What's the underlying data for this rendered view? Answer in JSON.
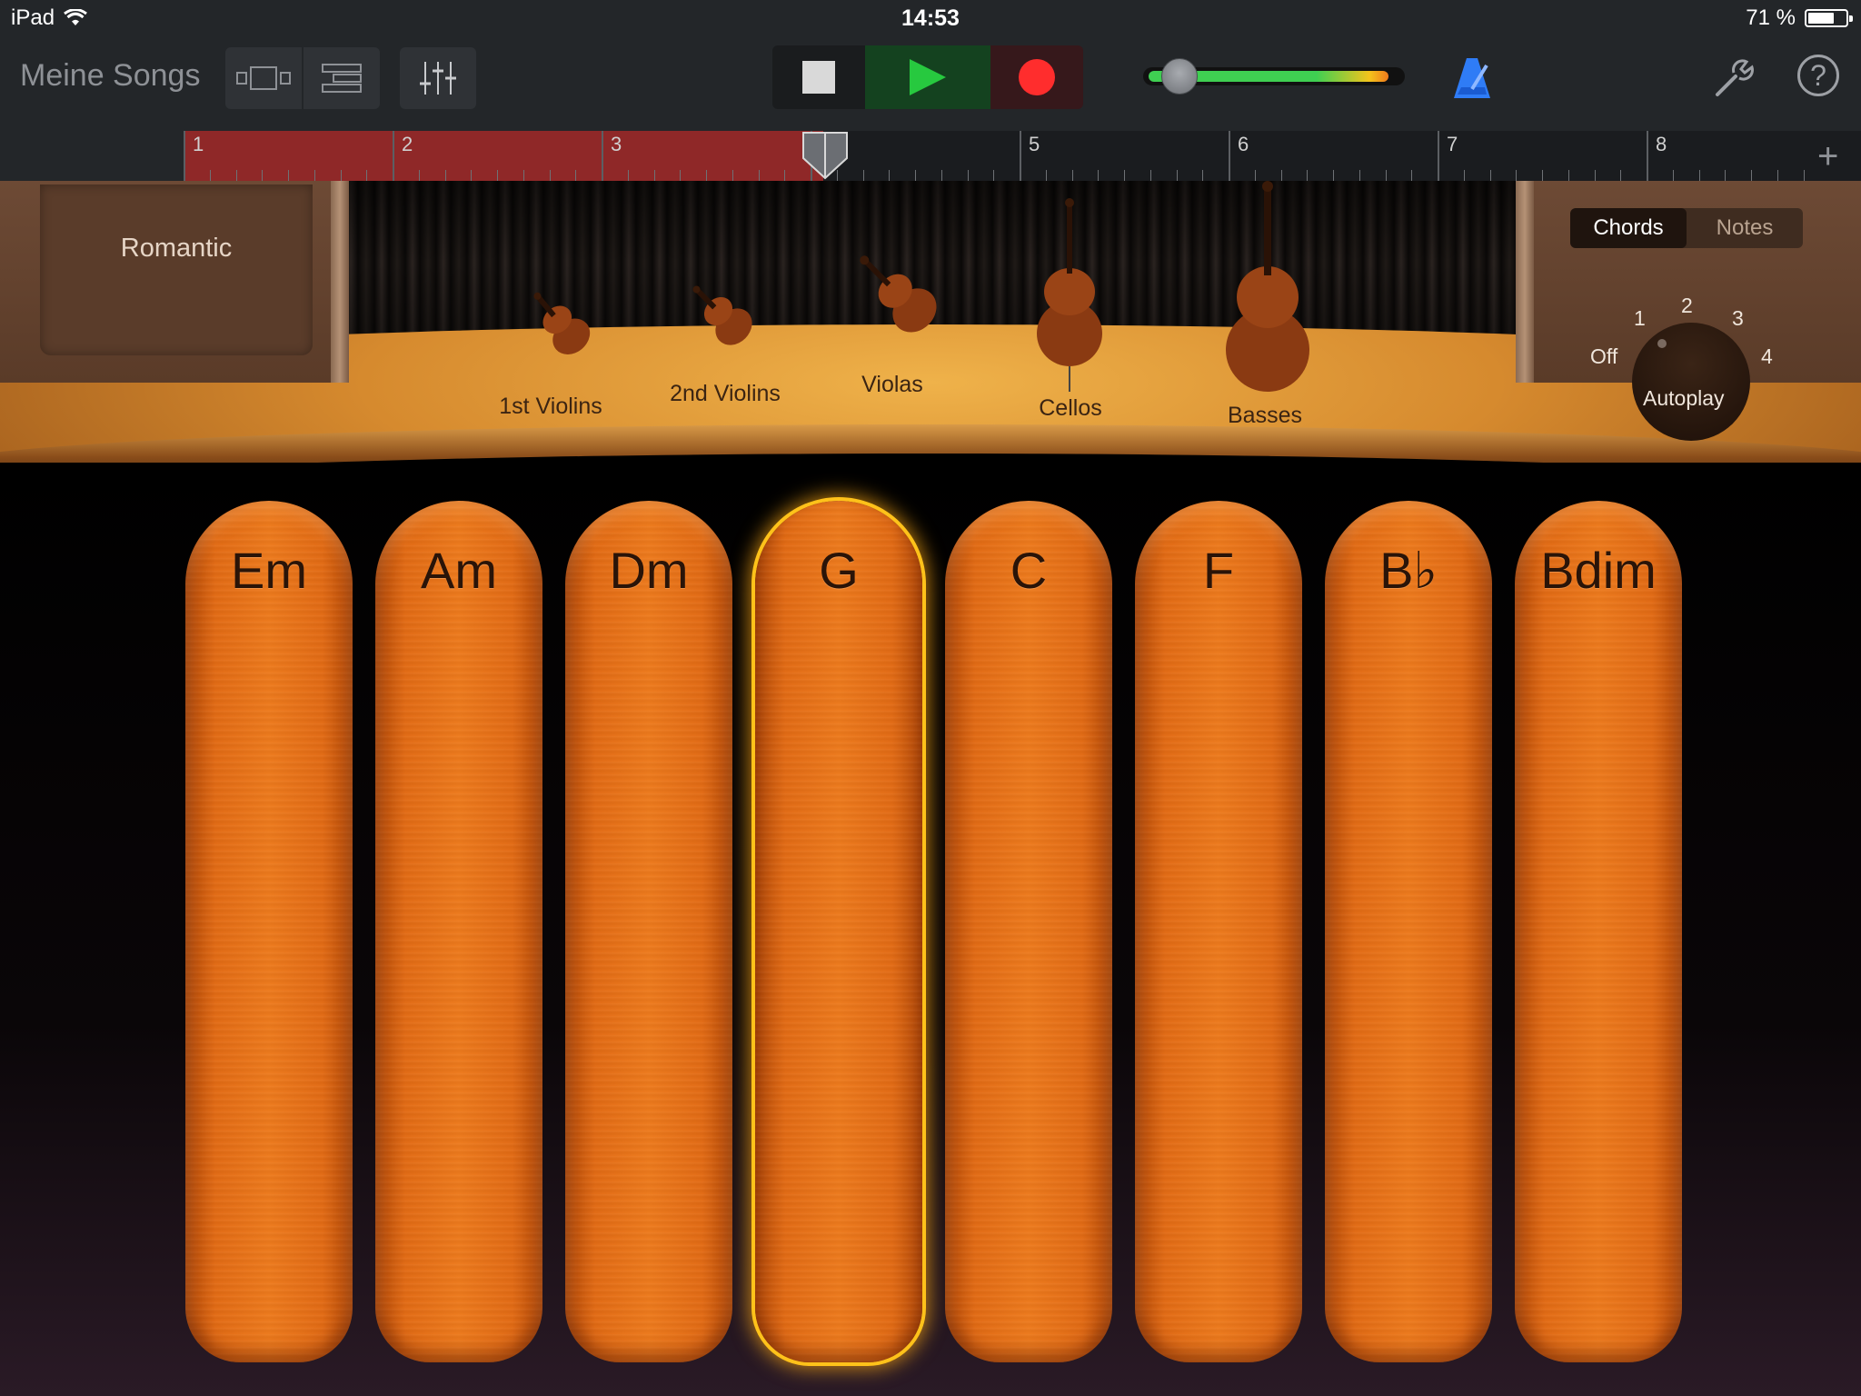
{
  "status_bar": {
    "device": "iPad",
    "time": "14:53",
    "battery_text": "71 %",
    "battery_level": 0.71
  },
  "toolbar": {
    "my_songs_label": "Meine Songs",
    "view_buttons": [
      "browser-view-icon",
      "tracks-view-icon"
    ],
    "mixer_icon": "mixer-icon",
    "transport": {
      "stop_icon": "stop-icon",
      "play_icon": "play-icon",
      "record_icon": "record-icon"
    },
    "volume_level": 0.14,
    "metronome_icon": "metronome-icon",
    "settings_icon": "wrench-icon",
    "help_label": "?"
  },
  "ruler": {
    "bars": [
      "1",
      "2",
      "3",
      "4",
      "5",
      "6",
      "7",
      "8"
    ],
    "region_end_bar": 4,
    "playhead_bar": 4,
    "add_label": "+"
  },
  "stage": {
    "style_name": "Romantic",
    "mode_options": [
      {
        "label": "Chords",
        "active": true
      },
      {
        "label": "Notes",
        "active": false
      }
    ],
    "autoplay": {
      "label": "Autoplay",
      "positions": [
        "Off",
        "1",
        "2",
        "3",
        "4"
      ],
      "selected": "Off"
    },
    "instruments": [
      "1st Violins",
      "2nd Violins",
      "Violas",
      "Cellos",
      "Basses"
    ]
  },
  "chords": [
    "Em",
    "Am",
    "Dm",
    "G",
    "C",
    "F",
    "B♭",
    "Bdim"
  ],
  "active_chord": "G",
  "colors": {
    "record": "#ff2d2d",
    "play": "#27c93f",
    "strip_orange": "#ee7a1c",
    "strip_glow": "#ffc21a",
    "region_red": "#8f2828",
    "metronome_blue": "#2f7cf6"
  }
}
